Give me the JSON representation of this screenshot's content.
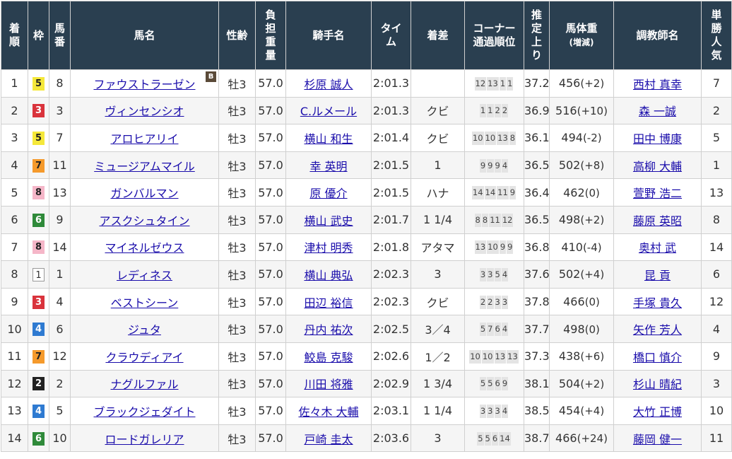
{
  "headers": {
    "rank": [
      "着",
      "順"
    ],
    "waku": [
      "枠"
    ],
    "umaban": [
      "馬",
      "番"
    ],
    "horse": [
      "馬名"
    ],
    "sexage": [
      "性齢"
    ],
    "weight": [
      "負",
      "担",
      "重",
      "量"
    ],
    "jockey": [
      "騎手名"
    ],
    "time": [
      "タイ",
      "ム"
    ],
    "margin": [
      "着差"
    ],
    "corner": [
      "コーナー",
      "通過順位"
    ],
    "last3f": [
      "推",
      "定",
      "上",
      "り"
    ],
    "bodyweight": [
      "馬体重",
      "(増減)"
    ],
    "trainer": [
      "調教師名"
    ],
    "odds": [
      "単",
      "勝",
      "人",
      "気"
    ]
  },
  "blinker_label": "B",
  "colors": {
    "header_bg": "#2a3f50",
    "link": "#1a0dab",
    "row_alt": "#f5f5f5"
  },
  "rows": [
    {
      "rank": "1",
      "waku": "5",
      "umaban": "8",
      "horse": "ファウストラーゼン",
      "blinker": true,
      "sexage": "牡3",
      "weight": "57.0",
      "jockey": "杉原 誠人",
      "time": "2:01.3",
      "margin": "",
      "corner": [
        "12",
        "13",
        "1",
        "1"
      ],
      "last3f": "37.2",
      "bw": "456",
      "bwdiff": "(+2)",
      "trainer": "西村 真幸",
      "pop": "7"
    },
    {
      "rank": "2",
      "waku": "3",
      "umaban": "3",
      "horse": "ヴィンセンシオ",
      "blinker": false,
      "sexage": "牡3",
      "weight": "57.0",
      "jockey": "C.ルメール",
      "time": "2:01.3",
      "margin": "クビ",
      "corner": [
        "1",
        "1",
        "2",
        "2"
      ],
      "last3f": "36.9",
      "bw": "516",
      "bwdiff": "(+10)",
      "trainer": "森 一誠",
      "pop": "2"
    },
    {
      "rank": "3",
      "waku": "5",
      "umaban": "7",
      "horse": "アロヒアリイ",
      "blinker": false,
      "sexage": "牡3",
      "weight": "57.0",
      "jockey": "横山 和生",
      "time": "2:01.4",
      "margin": "クビ",
      "corner": [
        "10",
        "10",
        "13",
        "8"
      ],
      "last3f": "36.1",
      "bw": "494",
      "bwdiff": "(-2)",
      "trainer": "田中 博康",
      "pop": "5"
    },
    {
      "rank": "4",
      "waku": "7",
      "umaban": "11",
      "horse": "ミュージアムマイル",
      "blinker": false,
      "sexage": "牡3",
      "weight": "57.0",
      "jockey": "幸 英明",
      "time": "2:01.5",
      "margin": "1",
      "corner": [
        "9",
        "9",
        "9",
        "4"
      ],
      "last3f": "36.5",
      "bw": "502",
      "bwdiff": "(+8)",
      "trainer": "高柳 大輔",
      "pop": "1"
    },
    {
      "rank": "5",
      "waku": "8",
      "umaban": "13",
      "horse": "ガンバルマン",
      "blinker": false,
      "sexage": "牡3",
      "weight": "57.0",
      "jockey": "原 優介",
      "time": "2:01.5",
      "margin": "ハナ",
      "corner": [
        "14",
        "14",
        "11",
        "9"
      ],
      "last3f": "36.4",
      "bw": "462",
      "bwdiff": "(0)",
      "trainer": "萱野 浩二",
      "pop": "13"
    },
    {
      "rank": "6",
      "waku": "6",
      "umaban": "9",
      "horse": "アスクシュタイン",
      "blinker": false,
      "sexage": "牡3",
      "weight": "57.0",
      "jockey": "横山 武史",
      "time": "2:01.7",
      "margin": "1 1/4",
      "corner": [
        "8",
        "8",
        "11",
        "12"
      ],
      "last3f": "36.5",
      "bw": "498",
      "bwdiff": "(+2)",
      "trainer": "藤原 英昭",
      "pop": "8"
    },
    {
      "rank": "7",
      "waku": "8",
      "umaban": "14",
      "horse": "マイネルゼウス",
      "blinker": false,
      "sexage": "牡3",
      "weight": "57.0",
      "jockey": "津村 明秀",
      "time": "2:01.8",
      "margin": "アタマ",
      "corner": [
        "13",
        "10",
        "9",
        "9"
      ],
      "last3f": "36.8",
      "bw": "410",
      "bwdiff": "(-4)",
      "trainer": "奥村 武",
      "pop": "14"
    },
    {
      "rank": "8",
      "waku": "1",
      "umaban": "1",
      "horse": "レディネス",
      "blinker": false,
      "sexage": "牡3",
      "weight": "57.0",
      "jockey": "横山 典弘",
      "time": "2:02.3",
      "margin": "3",
      "corner": [
        "3",
        "3",
        "5",
        "4"
      ],
      "last3f": "37.6",
      "bw": "502",
      "bwdiff": "(+4)",
      "trainer": "昆 貢",
      "pop": "6"
    },
    {
      "rank": "9",
      "waku": "3",
      "umaban": "4",
      "horse": "ベストシーン",
      "blinker": false,
      "sexage": "牡3",
      "weight": "57.0",
      "jockey": "田辺 裕信",
      "time": "2:02.3",
      "margin": "クビ",
      "corner": [
        "2",
        "2",
        "3",
        "3"
      ],
      "last3f": "37.8",
      "bw": "466",
      "bwdiff": "(0)",
      "trainer": "手塚 貴久",
      "pop": "12"
    },
    {
      "rank": "10",
      "waku": "4",
      "umaban": "6",
      "horse": "ジュタ",
      "blinker": false,
      "sexage": "牡3",
      "weight": "57.0",
      "jockey": "丹内 祐次",
      "time": "2:02.5",
      "margin": "3／4",
      "corner": [
        "5",
        "7",
        "6",
        "4"
      ],
      "last3f": "37.7",
      "bw": "498",
      "bwdiff": "(0)",
      "trainer": "矢作 芳人",
      "pop": "4"
    },
    {
      "rank": "11",
      "waku": "7",
      "umaban": "12",
      "horse": "クラウディアイ",
      "blinker": false,
      "sexage": "牡3",
      "weight": "57.0",
      "jockey": "鮫島 克駿",
      "time": "2:02.6",
      "margin": "1／2",
      "corner": [
        "10",
        "10",
        "13",
        "13"
      ],
      "last3f": "37.3",
      "bw": "438",
      "bwdiff": "(+6)",
      "trainer": "橋口 慎介",
      "pop": "9"
    },
    {
      "rank": "12",
      "waku": "2",
      "umaban": "2",
      "horse": "ナグルファル",
      "blinker": false,
      "sexage": "牡3",
      "weight": "57.0",
      "jockey": "川田 将雅",
      "time": "2:02.9",
      "margin": "1 3/4",
      "corner": [
        "5",
        "5",
        "6",
        "9"
      ],
      "last3f": "38.1",
      "bw": "504",
      "bwdiff": "(+2)",
      "trainer": "杉山 晴紀",
      "pop": "3"
    },
    {
      "rank": "13",
      "waku": "4",
      "umaban": "5",
      "horse": "ブラックジェダイト",
      "blinker": false,
      "sexage": "牡3",
      "weight": "57.0",
      "jockey": "佐々木 大輔",
      "time": "2:03.1",
      "margin": "1 1/4",
      "corner": [
        "3",
        "3",
        "3",
        "4"
      ],
      "last3f": "38.5",
      "bw": "454",
      "bwdiff": "(+4)",
      "trainer": "大竹 正博",
      "pop": "10"
    },
    {
      "rank": "14",
      "waku": "6",
      "umaban": "10",
      "horse": "ロードガレリア",
      "blinker": false,
      "sexage": "牡3",
      "weight": "57.0",
      "jockey": "戸崎 圭太",
      "time": "2:03.6",
      "margin": "3",
      "corner": [
        "5",
        "5",
        "6",
        "14"
      ],
      "last3f": "38.7",
      "bw": "466",
      "bwdiff": "(+24)",
      "trainer": "藤岡 健一",
      "pop": "11"
    }
  ]
}
